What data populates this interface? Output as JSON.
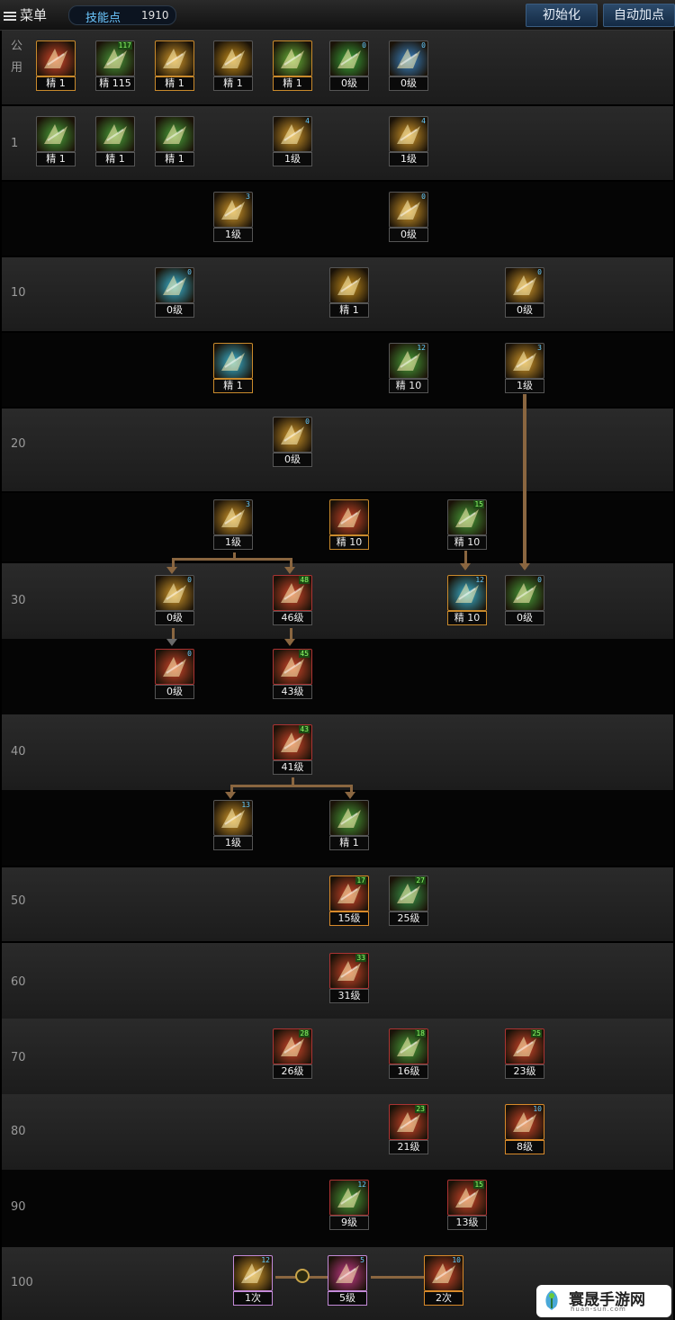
{
  "menu_label": "菜单",
  "skill_points": {
    "label": "技能点",
    "value": "1910"
  },
  "buttons": {
    "reset": "初始化",
    "auto": "自动加点"
  },
  "row_labels": [
    "公\n用",
    "1",
    "",
    "10",
    "",
    "20",
    "",
    "30",
    "",
    "40",
    "",
    "50",
    "60",
    "70",
    "80",
    "90",
    "100"
  ],
  "skills": [
    {
      "name": "skill-passive-1",
      "level": "精 1",
      "badge": "",
      "frame": "gold",
      "color": "#d4472a"
    },
    {
      "name": "skill-passive-2",
      "level": "精 115",
      "badge": "117",
      "frame": "",
      "color": "#4a9a3a"
    },
    {
      "name": "skill-passive-3",
      "level": "精 1",
      "badge": "",
      "frame": "gold",
      "color": "#d49a2a"
    },
    {
      "name": "skill-passive-4",
      "level": "精 1",
      "badge": "",
      "frame": "",
      "color": "#c8901c"
    },
    {
      "name": "skill-passive-5",
      "level": "精 1",
      "badge": "",
      "frame": "gold",
      "color": "#6ab63a"
    },
    {
      "name": "skill-target",
      "level": "0级",
      "badge": "0",
      "frame": "",
      "color": "#3aa63a"
    },
    {
      "name": "skill-wings",
      "level": "0级",
      "badge": "0",
      "frame": "",
      "color": "#3a86c8"
    },
    {
      "name": "skill-r1-a",
      "level": "精 1",
      "badge": "",
      "frame": "",
      "color": "#4aa23a"
    },
    {
      "name": "skill-r1-b",
      "level": "精 1",
      "badge": "",
      "frame": "",
      "color": "#4aa23a"
    },
    {
      "name": "skill-r1-c",
      "level": "精 1",
      "badge": "",
      "frame": "",
      "color": "#4aa23a"
    },
    {
      "name": "skill-r1-d",
      "level": "1级",
      "badge": "4",
      "frame": "",
      "color": "#d49a2a"
    },
    {
      "name": "skill-r1-e",
      "level": "1级",
      "badge": "4",
      "frame": "",
      "color": "#d49a2a"
    },
    {
      "name": "skill-r2-a",
      "level": "1级",
      "badge": "3",
      "frame": "",
      "color": "#d49a2a"
    },
    {
      "name": "skill-r2-b",
      "level": "0级",
      "badge": "0",
      "frame": "",
      "color": "#d49a2a"
    },
    {
      "name": "skill-r3-a",
      "level": "0级",
      "badge": "0",
      "frame": "",
      "color": "#3ab6d4"
    },
    {
      "name": "skill-r3-b",
      "level": "精 1",
      "badge": "",
      "frame": "",
      "color": "#c8901c"
    },
    {
      "name": "skill-r3-c",
      "level": "0级",
      "badge": "0",
      "frame": "",
      "color": "#d49a2a"
    },
    {
      "name": "skill-r4-a",
      "level": "精 1",
      "badge": "",
      "frame": "gold",
      "color": "#3ab6d4"
    },
    {
      "name": "skill-r4-b",
      "level": "精 10",
      "badge": "12",
      "frame": "",
      "color": "#4aa23a"
    },
    {
      "name": "skill-r4-c",
      "level": "1级",
      "badge": "3",
      "frame": "",
      "color": "#d49a2a"
    },
    {
      "name": "skill-r5-a",
      "level": "0级",
      "badge": "0",
      "frame": "",
      "color": "#d49a2a"
    },
    {
      "name": "skill-r6-a",
      "level": "1级",
      "badge": "3",
      "frame": "",
      "color": "#d49a2a"
    },
    {
      "name": "skill-r6-b",
      "level": "精 10",
      "badge": "",
      "frame": "gold",
      "color": "#d4472a"
    },
    {
      "name": "skill-r6-c",
      "level": "精 10",
      "badge": "15",
      "frame": "",
      "color": "#4aa23a"
    },
    {
      "name": "skill-r7-a",
      "level": "0级",
      "badge": "0",
      "frame": "",
      "color": "#d49a2a"
    },
    {
      "name": "skill-r7-b",
      "level": "46级",
      "badge": "48",
      "frame": "red",
      "color": "#d4472a"
    },
    {
      "name": "skill-r7-c",
      "level": "精 10",
      "badge": "12",
      "frame": "gold",
      "color": "#3ab6d4"
    },
    {
      "name": "skill-r7-d",
      "level": "0级",
      "badge": "0",
      "frame": "",
      "color": "#4aa23a"
    },
    {
      "name": "skill-r8-a",
      "level": "0级",
      "badge": "0",
      "frame": "red",
      "color": "#d4472a"
    },
    {
      "name": "skill-r8-b",
      "level": "43级",
      "badge": "45",
      "frame": "red",
      "color": "#d4472a"
    },
    {
      "name": "skill-r9-a",
      "level": "41级",
      "badge": "43",
      "frame": "red",
      "color": "#d4472a"
    },
    {
      "name": "skill-r10-a",
      "level": "1级",
      "badge": "13",
      "frame": "",
      "color": "#d49a2a"
    },
    {
      "name": "skill-r10-b",
      "level": "精 1",
      "badge": "",
      "frame": "",
      "color": "#4aa23a"
    },
    {
      "name": "skill-r11-a",
      "level": "15级",
      "badge": "17",
      "frame": "orange",
      "color": "#d4472a"
    },
    {
      "name": "skill-r11-b",
      "level": "25级",
      "badge": "27",
      "frame": "",
      "color": "#3a9a4a"
    },
    {
      "name": "skill-r12-a",
      "level": "31级",
      "badge": "33",
      "frame": "red",
      "color": "#d4472a"
    },
    {
      "name": "skill-r13-a",
      "level": "26级",
      "badge": "28",
      "frame": "red",
      "color": "#d4472a"
    },
    {
      "name": "skill-r13-b",
      "level": "16级",
      "badge": "18",
      "frame": "red",
      "color": "#4aa23a"
    },
    {
      "name": "skill-r13-c",
      "level": "23级",
      "badge": "25",
      "frame": "red",
      "color": "#d4472a"
    },
    {
      "name": "skill-r14-a",
      "level": "21级",
      "badge": "23",
      "frame": "red",
      "color": "#d4472a"
    },
    {
      "name": "skill-r14-b",
      "level": "8级",
      "badge": "10",
      "frame": "orange",
      "color": "#d4472a"
    },
    {
      "name": "skill-r15-a",
      "level": "9级",
      "badge": "12",
      "frame": "red",
      "color": "#4aa23a"
    },
    {
      "name": "skill-r15-b",
      "level": "13级",
      "badge": "15",
      "frame": "red",
      "color": "#d4472a"
    },
    {
      "name": "skill-r16-a",
      "level": "1次",
      "badge": "12",
      "frame": "purple",
      "color": "#d49a2a"
    },
    {
      "name": "skill-r16-b",
      "level": "5级",
      "badge": "5",
      "frame": "purple",
      "color": "#c83a8a"
    },
    {
      "name": "skill-r16-c",
      "level": "2次",
      "badge": "10",
      "frame": "orange",
      "color": "#d4472a"
    }
  ],
  "watermark": {
    "text": "寰晟手游网",
    "url": "huan-sun.com"
  },
  "colors": {
    "connector": "#8a6640",
    "accent_blue": "#6cc8ff"
  }
}
